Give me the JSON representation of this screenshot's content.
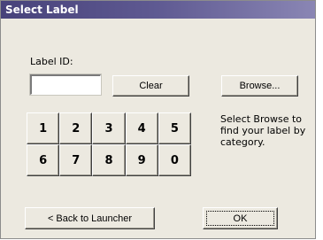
{
  "window": {
    "title": "Select Label"
  },
  "label_id": {
    "label": "Label ID:",
    "value": ""
  },
  "buttons": {
    "clear": "Clear",
    "browse": "Browse...",
    "back": "< Back to Launcher",
    "ok": "OK"
  },
  "keypad": {
    "keys": [
      "1",
      "2",
      "3",
      "4",
      "5",
      "6",
      "7",
      "8",
      "9",
      "0"
    ]
  },
  "hint": "Select Browse to find your label by category."
}
